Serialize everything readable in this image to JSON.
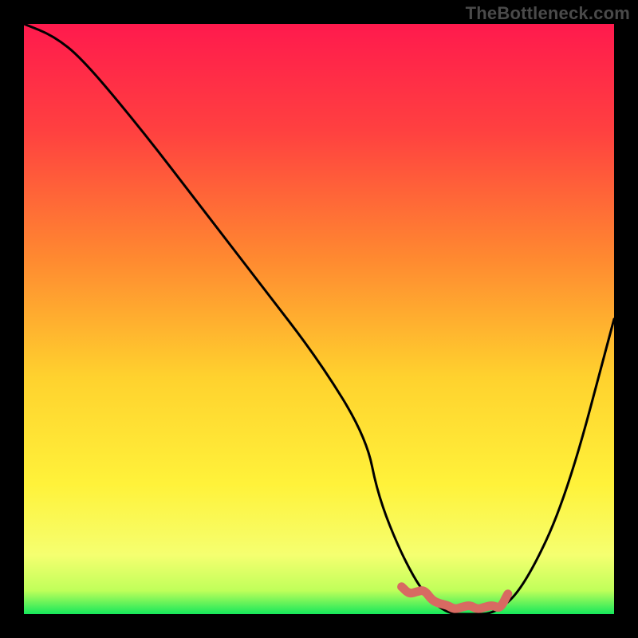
{
  "watermark": "TheBottleneck.com",
  "colors": {
    "bg_black": "#000000",
    "grad_top": "#ff1a4d",
    "grad_q1": "#ff5a3a",
    "grad_mid": "#ffb52e",
    "grad_q3": "#fff23a",
    "grad_bottom_yellow": "#f8ff66",
    "grad_green": "#1df060",
    "curve": "#000000",
    "highlight": "#d86a62",
    "watermark": "#4a4a4a"
  },
  "chart_data": {
    "type": "line",
    "x": [
      0,
      5,
      10,
      20,
      30,
      40,
      50,
      58,
      60,
      64,
      68,
      72,
      75,
      80,
      85,
      92,
      100
    ],
    "values": [
      100,
      98,
      94,
      82,
      69,
      56,
      43,
      30,
      20,
      10,
      3,
      0,
      0,
      0,
      5,
      20,
      50
    ],
    "title": "",
    "xlabel": "",
    "ylabel": "",
    "xlim": [
      0,
      100
    ],
    "ylim": [
      0,
      100
    ],
    "highlight_segment": {
      "x_start": 64,
      "x_end": 82,
      "note": "optimal zone marked near trough"
    }
  }
}
